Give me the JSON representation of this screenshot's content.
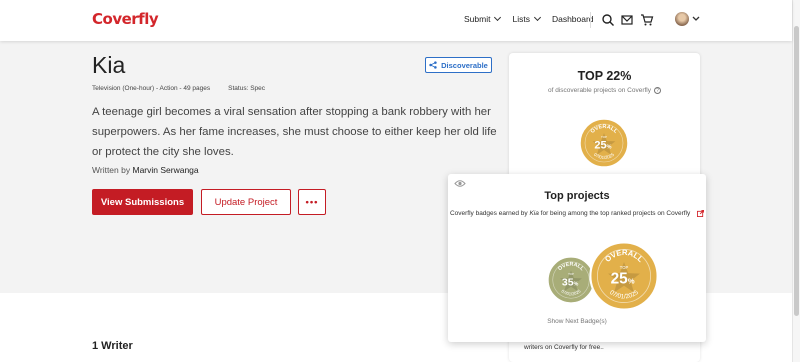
{
  "header": {
    "logo": "Coverfly",
    "nav": [
      {
        "label": "Submit"
      },
      {
        "label": "Lists"
      },
      {
        "label": "Dashboard"
      }
    ]
  },
  "project": {
    "title": "Kia",
    "format": "Television (One-hour) - Action - 49 pages",
    "status": "Status: Spec",
    "logline": "A teenage girl becomes a viral sensation after stopping a bank robbery with her superpowers. As her fame increases, she must choose to either keep her old life or protect the city she loves.",
    "written_by_label": "Written by",
    "author": "Marvin Serwanga",
    "discoverable_label": "Discoverable",
    "buttons": {
      "view_submissions": "View Submissions",
      "update_project": "Update Project",
      "more": "•••"
    }
  },
  "rank_card": {
    "top_pct": "TOP 22%",
    "subtitle": "of discoverable projects on Coverfly",
    "question": "?",
    "bottom_text": "writers on Coverfly for free.."
  },
  "popover": {
    "title": "Top projects",
    "desc_prefix": "Coverfly badges earned by ",
    "desc_project": "Kia",
    "desc_suffix": " for being among the top ranked projects on Coverfly",
    "show_next": "Show Next Badge(s)"
  },
  "badges": {
    "card_badge": {
      "label": "OVERALL",
      "top": "TOP",
      "pct": "25",
      "pct_sign": "%",
      "date": "07/01/2025",
      "color": "#e2b04a"
    },
    "small_badge": {
      "label": "OVERALL",
      "top": "TOP",
      "pct": "35",
      "pct_sign": "%",
      "date": "07/01/2025",
      "color": "#a8ad78"
    },
    "large_badge": {
      "label": "OVERALL",
      "top": "TOP",
      "pct": "25",
      "pct_sign": "%",
      "date": "07/01/2025",
      "color": "#e2b04a"
    }
  },
  "sections": {
    "writers_heading": "1 Writer"
  },
  "colors": {
    "brand": "#d3262b",
    "primary_button": "#c41c24",
    "discoverable": "#2d6fc7"
  }
}
